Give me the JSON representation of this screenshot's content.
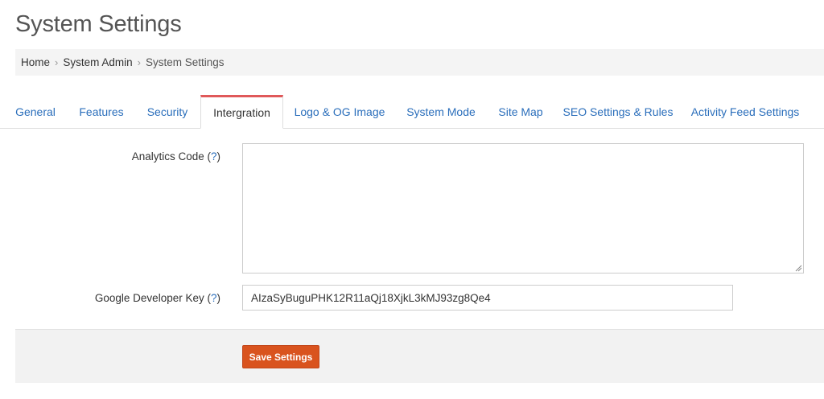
{
  "page": {
    "title": "System Settings"
  },
  "breadcrumb": {
    "items": [
      "Home",
      "System Admin",
      "System Settings"
    ],
    "separator": "›"
  },
  "tabs": [
    {
      "label": "General",
      "active": false
    },
    {
      "label": "Features",
      "active": false
    },
    {
      "label": "Security",
      "active": false
    },
    {
      "label": "Intergration",
      "active": true
    },
    {
      "label": "Logo & OG Image",
      "active": false
    },
    {
      "label": "System Mode",
      "active": false
    },
    {
      "label": "Site Map",
      "active": false
    },
    {
      "label": "SEO Settings & Rules",
      "active": false
    },
    {
      "label": "Activity Feed Settings",
      "active": false
    }
  ],
  "form": {
    "analytics_code": {
      "label": "Analytics Code",
      "help": "?",
      "value": ""
    },
    "google_developer_key": {
      "label": "Google Developer Key",
      "help": "?",
      "value": "AIzaSyBuguPHK12R11aQj18XjkL3kMJ93zg8Qe4"
    },
    "save_label": "Save Settings"
  },
  "colors": {
    "link": "#2a6ebb",
    "active_tab_accent": "#e0595a",
    "save_button": "#d9531e",
    "footer_bg": "#f2f2f2"
  }
}
